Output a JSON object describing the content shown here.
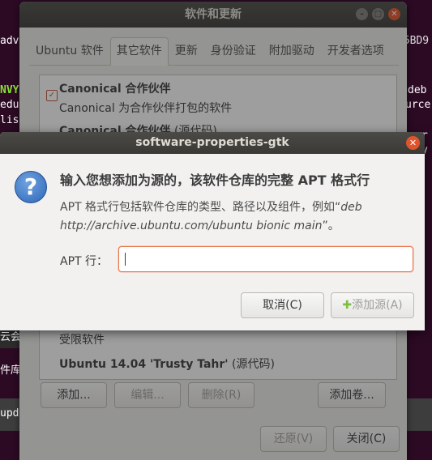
{
  "terminal": {
    "lines": [
      {
        "text": "adv",
        "green": false
      },
      {
        "text": "NVY",
        "green": true
      },
      {
        "text": "edu",
        "green": false
      },
      {
        "text": "lis",
        "green": false
      }
    ],
    "right_lines": [
      "65BD9",
      "deb",
      "urce",
      "r",
      "y"
    ],
    "left_fragments": [
      "云会",
      "件库",
      "upd"
    ]
  },
  "window": {
    "title": "软件和更新",
    "tabs": [
      "Ubuntu 软件",
      "其它软件",
      "更新",
      "身份验证",
      "附加驱动",
      "开发者选项"
    ],
    "active_tab": 1,
    "list": {
      "item1_title": "Canonical 合作伙伴",
      "item1_sub": "Canonical 为合作伙伴打包的软件",
      "item2_title": "Canonical 合作伙伴",
      "item2_suffix": " (源代码)",
      "item3": "受限软件",
      "item4_title": "Ubuntu 14.04 'Trusty Tahr'",
      "item4_suffix": " (源代码)"
    },
    "buttons": {
      "add": "添加...",
      "edit": "编辑...",
      "remove": "删除(R)",
      "add_volume": "添加卷...",
      "revert": "还原(V)",
      "close": "关闭(C)"
    }
  },
  "dialog": {
    "title": "software-properties-gtk",
    "heading": "输入您想添加为源的，该软件仓库的完整 APT 格式行",
    "desc_prefix": "APT 格式行包括软件仓库的类型、路径以及组件，例如“",
    "desc_example": "deb http://archive.ubuntu.com/ubuntu bionic main",
    "desc_suffix": "”。",
    "apt_label": "APT 行：",
    "apt_value": "",
    "cancel": "取消(C)",
    "add_source": "添加源(A)"
  },
  "colors": {
    "accent": "#e9734a",
    "titlebar": "#3b3a37",
    "close": "#e0542b"
  }
}
